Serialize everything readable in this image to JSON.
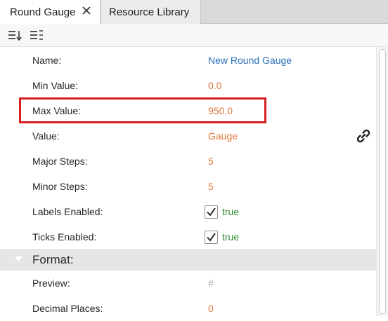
{
  "tabs": [
    {
      "label": "Round Gauge",
      "active": true
    },
    {
      "label": "Resource Library",
      "active": false
    }
  ],
  "toolbar": {
    "sort_icon": "sort-list-icon",
    "categorize_icon": "categorized-list-icon"
  },
  "properties": [
    {
      "label": "Name:",
      "value": "New Round Gauge",
      "color": "#2a6fb8"
    },
    {
      "label": "Min Value:",
      "value": "0.0",
      "color": "#e0763a"
    },
    {
      "label": "Max Value:",
      "value": "950.0",
      "color": "#e0763a"
    },
    {
      "label": "Value:",
      "value": "Gauge",
      "color": "#e0763a"
    },
    {
      "label": "Major Steps:",
      "value": "5",
      "color": "#e0763a"
    },
    {
      "label": "Minor Steps:",
      "value": "5",
      "color": "#e0763a"
    },
    {
      "label": "Labels Enabled:",
      "value": "true",
      "checked": true,
      "color": "#2e8b2e"
    },
    {
      "label": "Ticks Enabled:",
      "value": "true",
      "checked": true,
      "color": "#2e8b2e"
    }
  ],
  "format_section": {
    "label": "Format:",
    "expanded": true,
    "properties": [
      {
        "label": "Preview:",
        "value": "#",
        "color": "#a8a8a8"
      },
      {
        "label": "Decimal Places:",
        "value": "0",
        "color": "#e0763a"
      }
    ]
  },
  "highlight_color": "#d62020"
}
